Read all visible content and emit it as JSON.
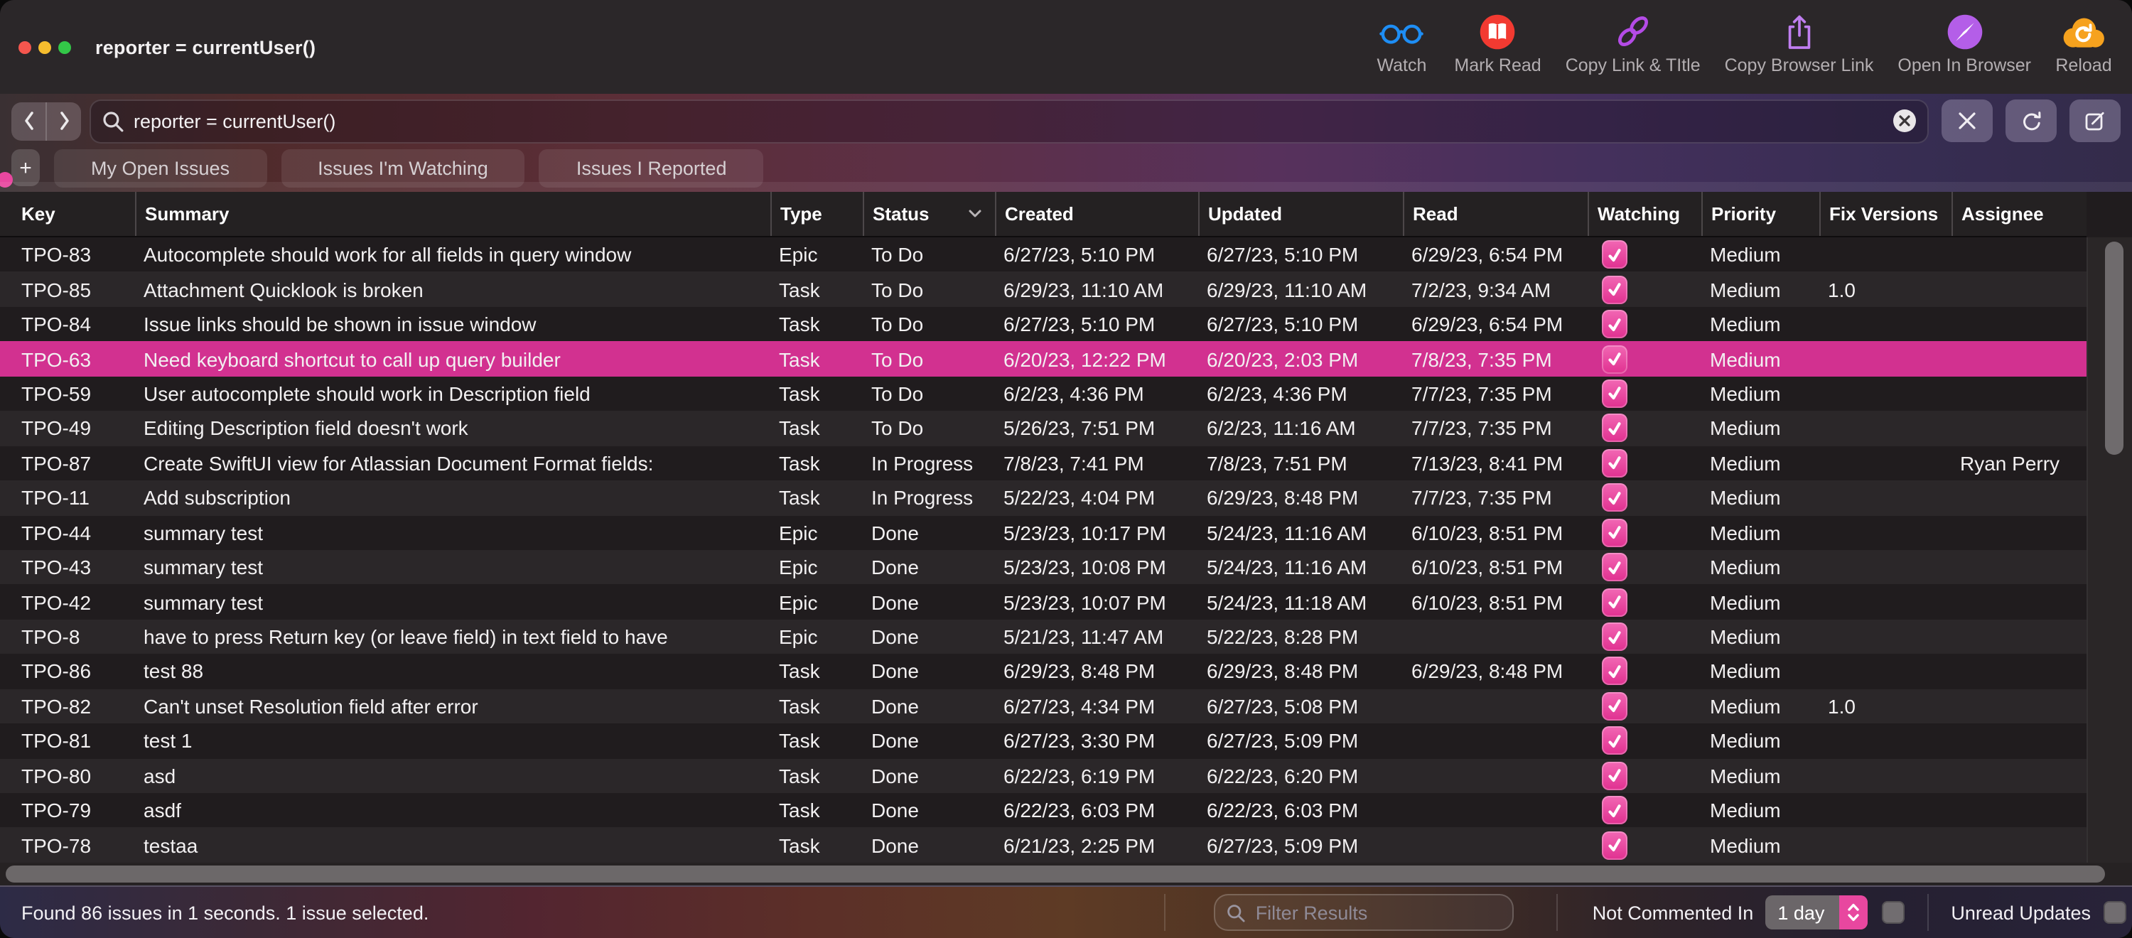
{
  "window": {
    "title": "reporter = currentUser()"
  },
  "toolbar": {
    "items": [
      {
        "label": "Watch",
        "icon": "glasses-icon"
      },
      {
        "label": "Mark Read",
        "icon": "open-book-icon"
      },
      {
        "label": "Copy Link & TItle",
        "icon": "chain-link-icon"
      },
      {
        "label": "Copy Browser Link",
        "icon": "share-icon"
      },
      {
        "label": "Open In Browser",
        "icon": "compass-icon"
      },
      {
        "label": "Reload",
        "icon": "cloud-refresh-icon"
      }
    ]
  },
  "searchbar": {
    "query": "reporter = currentUser()"
  },
  "tabs": [
    {
      "label": "My Open Issues"
    },
    {
      "label": "Issues I'm Watching"
    },
    {
      "label": "Issues I Reported"
    }
  ],
  "table": {
    "columns": [
      {
        "label": "Key"
      },
      {
        "label": "Summary"
      },
      {
        "label": "Type"
      },
      {
        "label": "Status",
        "sorted": true
      },
      {
        "label": "Created"
      },
      {
        "label": "Updated"
      },
      {
        "label": "Read"
      },
      {
        "label": "Watching"
      },
      {
        "label": "Priority"
      },
      {
        "label": "Fix Versions"
      },
      {
        "label": "Assignee"
      }
    ],
    "rows": [
      {
        "key": "TPO-83",
        "summary": "Autocomplete should work for all fields in query window",
        "type": "Epic",
        "status": "To Do",
        "created": "6/27/23, 5:10 PM",
        "updated": "6/27/23, 5:10 PM",
        "read": "6/29/23, 6:54 PM",
        "watching": true,
        "priority": "Medium",
        "fix_versions": "",
        "assignee": ""
      },
      {
        "key": "TPO-85",
        "summary": "Attachment Quicklook is broken",
        "type": "Task",
        "status": "To Do",
        "created": "6/29/23, 11:10 AM",
        "updated": "6/29/23, 11:10 AM",
        "read": "7/2/23, 9:34 AM",
        "watching": true,
        "priority": "Medium",
        "fix_versions": "1.0",
        "assignee": ""
      },
      {
        "key": "TPO-84",
        "summary": "Issue links should be shown in issue window",
        "type": "Task",
        "status": "To Do",
        "created": "6/27/23, 5:10 PM",
        "updated": "6/27/23, 5:10 PM",
        "read": "6/29/23, 6:54 PM",
        "watching": true,
        "priority": "Medium",
        "fix_versions": "",
        "assignee": ""
      },
      {
        "key": "TPO-63",
        "summary": "Need keyboard shortcut to call up query builder",
        "type": "Task",
        "status": "To Do",
        "created": "6/20/23, 12:22 PM",
        "updated": "6/20/23, 2:03 PM",
        "read": "7/8/23, 7:35 PM",
        "watching": true,
        "priority": "Medium",
        "fix_versions": "",
        "assignee": "",
        "selected": true
      },
      {
        "key": "TPO-59",
        "summary": "User autocomplete should work in Description field",
        "type": "Task",
        "status": "To Do",
        "created": "6/2/23, 4:36 PM",
        "updated": "6/2/23, 4:36 PM",
        "read": "7/7/23, 7:35 PM",
        "watching": true,
        "priority": "Medium",
        "fix_versions": "",
        "assignee": ""
      },
      {
        "key": "TPO-49",
        "summary": "Editing Description field doesn't work",
        "type": "Task",
        "status": "To Do",
        "created": "5/26/23, 7:51 PM",
        "updated": "6/2/23, 11:16 AM",
        "read": "7/7/23, 7:35 PM",
        "watching": true,
        "priority": "Medium",
        "fix_versions": "",
        "assignee": ""
      },
      {
        "key": "TPO-87",
        "summary": "Create SwiftUI view for Atlassian Document Format fields:",
        "type": "Task",
        "status": "In Progress",
        "created": "7/8/23, 7:41 PM",
        "updated": "7/8/23, 7:51 PM",
        "read": "7/13/23, 8:41 PM",
        "watching": true,
        "priority": "Medium",
        "fix_versions": "",
        "assignee": "Ryan Perry"
      },
      {
        "key": "TPO-11",
        "summary": "Add subscription",
        "type": "Task",
        "status": "In Progress",
        "created": "5/22/23, 4:04 PM",
        "updated": "6/29/23, 8:48 PM",
        "read": "7/7/23, 7:35 PM",
        "watching": true,
        "priority": "Medium",
        "fix_versions": "",
        "assignee": ""
      },
      {
        "key": "TPO-44",
        "summary": "summary test",
        "type": "Epic",
        "status": "Done",
        "created": "5/23/23, 10:17 PM",
        "updated": "5/24/23, 11:16 AM",
        "read": "6/10/23, 8:51 PM",
        "watching": true,
        "priority": "Medium",
        "fix_versions": "",
        "assignee": ""
      },
      {
        "key": "TPO-43",
        "summary": "summary test",
        "type": "Epic",
        "status": "Done",
        "created": "5/23/23, 10:08 PM",
        "updated": "5/24/23, 11:16 AM",
        "read": "6/10/23, 8:51 PM",
        "watching": true,
        "priority": "Medium",
        "fix_versions": "",
        "assignee": ""
      },
      {
        "key": "TPO-42",
        "summary": "summary test",
        "type": "Epic",
        "status": "Done",
        "created": "5/23/23, 10:07 PM",
        "updated": "5/24/23, 11:18 AM",
        "read": "6/10/23, 8:51 PM",
        "watching": true,
        "priority": "Medium",
        "fix_versions": "",
        "assignee": ""
      },
      {
        "key": "TPO-8",
        "summary": "have to press Return key (or leave field) in text field to have",
        "type": "Epic",
        "status": "Done",
        "created": "5/21/23, 11:47 AM",
        "updated": "5/22/23, 8:28 PM",
        "read": "",
        "watching": true,
        "priority": "Medium",
        "fix_versions": "",
        "assignee": ""
      },
      {
        "key": "TPO-86",
        "summary": "test 88",
        "type": "Task",
        "status": "Done",
        "created": "6/29/23, 8:48 PM",
        "updated": "6/29/23, 8:48 PM",
        "read": "6/29/23, 8:48 PM",
        "watching": true,
        "priority": "Medium",
        "fix_versions": "",
        "assignee": ""
      },
      {
        "key": "TPO-82",
        "summary": "Can't unset Resolution field after error",
        "type": "Task",
        "status": "Done",
        "created": "6/27/23, 4:34 PM",
        "updated": "6/27/23, 5:08 PM",
        "read": "",
        "watching": true,
        "priority": "Medium",
        "fix_versions": "1.0",
        "assignee": ""
      },
      {
        "key": "TPO-81",
        "summary": "test 1",
        "type": "Task",
        "status": "Done",
        "created": "6/27/23, 3:30 PM",
        "updated": "6/27/23, 5:09 PM",
        "read": "",
        "watching": true,
        "priority": "Medium",
        "fix_versions": "",
        "assignee": ""
      },
      {
        "key": "TPO-80",
        "summary": "asd",
        "type": "Task",
        "status": "Done",
        "created": "6/22/23, 6:19 PM",
        "updated": "6/22/23, 6:20 PM",
        "read": "",
        "watching": true,
        "priority": "Medium",
        "fix_versions": "",
        "assignee": ""
      },
      {
        "key": "TPO-79",
        "summary": "asdf",
        "type": "Task",
        "status": "Done",
        "created": "6/22/23, 6:03 PM",
        "updated": "6/22/23, 6:03 PM",
        "read": "",
        "watching": true,
        "priority": "Medium",
        "fix_versions": "",
        "assignee": ""
      },
      {
        "key": "TPO-78",
        "summary": "testaa",
        "type": "Task",
        "status": "Done",
        "created": "6/21/23, 2:25 PM",
        "updated": "6/27/23, 5:09 PM",
        "read": "",
        "watching": true,
        "priority": "Medium",
        "fix_versions": "",
        "assignee": ""
      }
    ]
  },
  "statusbar": {
    "summary": "Found 86 issues in 1 seconds. 1 issue selected.",
    "filter_placeholder": "Filter Results",
    "not_commented_label": "Not Commented In",
    "not_commented_value": "1 day",
    "unread_label": "Unread Updates"
  },
  "colors": {
    "accent_pink": "#e8479f",
    "selected_row": "#d23190",
    "row_dark": "#201c1e",
    "row_light": "#2b2729",
    "titlebar_bg": "#2b2729",
    "traffic_red": "#f5564e",
    "traffic_yellow": "#f6bd2e",
    "traffic_green": "#33c748",
    "icon_watch": "#1e8ef5",
    "icon_mark_read": "#f23a31",
    "icon_copy_link": "#b44be6",
    "icon_copy_browser": "#c07ef0",
    "icon_open_browser": "#b45ee8",
    "icon_reload": "#f6a21e"
  }
}
